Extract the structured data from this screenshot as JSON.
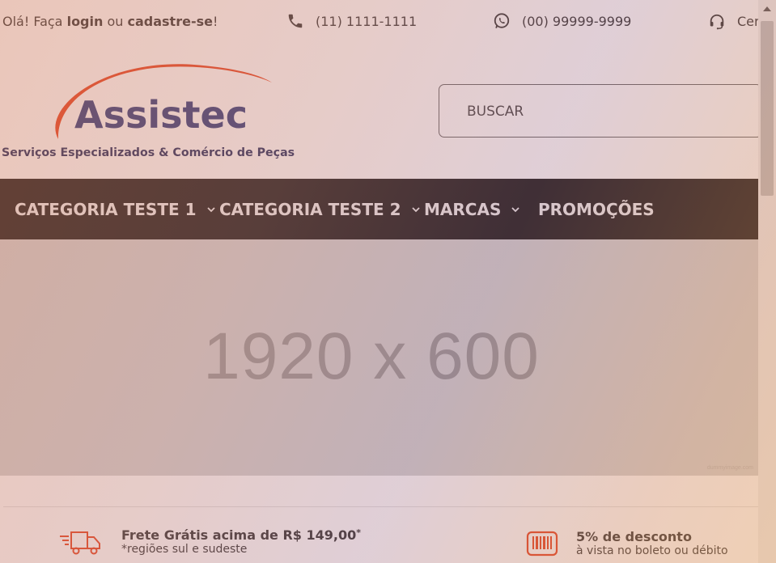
{
  "topbar": {
    "greeting_prefix": "Olá! Faça ",
    "login_label": "login",
    "or_text": " ou ",
    "register_label": "cadastre-se",
    "greeting_suffix": "!",
    "phone": "(11) 1111-1111",
    "whatsapp": "(00) 99999-9999",
    "support_label": "Cer"
  },
  "header": {
    "logo_name": "Assistec",
    "logo_tagline": "Serviços Especializados & Comércio de Peças",
    "search_placeholder": "BUSCAR"
  },
  "nav": {
    "items": [
      {
        "label": "CATEGORIA TESTE 1",
        "has_dropdown": true
      },
      {
        "label": "CATEGORIA TESTE 2",
        "has_dropdown": true
      },
      {
        "label": "MARCAS",
        "has_dropdown": true
      },
      {
        "label": "PROMOÇÕES",
        "has_dropdown": false
      }
    ]
  },
  "banner": {
    "text": "1920 x 600",
    "credit": "dummyimage.com"
  },
  "benefits": [
    {
      "icon": "truck-icon",
      "title": "Frete Grátis acima de R$ 149,00",
      "title_mark": "*",
      "subtitle": "*regiões sul e sudeste"
    },
    {
      "icon": "barcode-icon",
      "title": "5% de desconto",
      "subtitle": "à vista no boleto ou débito"
    }
  ],
  "colors": {
    "nav_background": "#1a1a1a",
    "accent_orange": "#e8421e",
    "logo_blue": "#2c3a7c",
    "overlay_tint": "#c97a5e"
  }
}
